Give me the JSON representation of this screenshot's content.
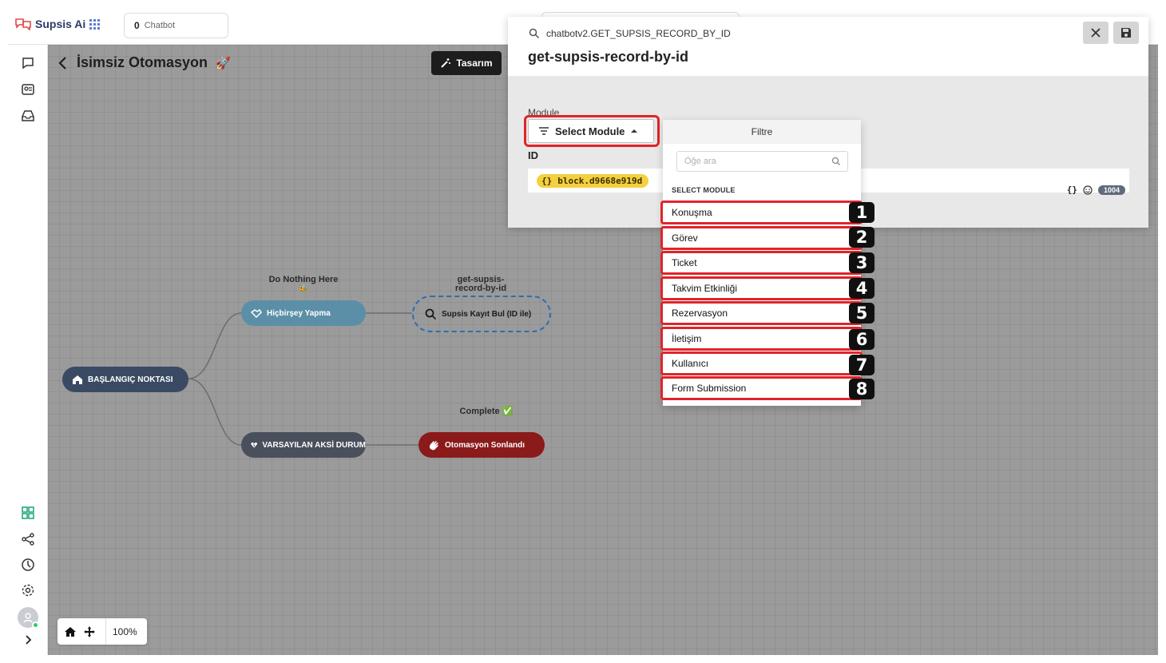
{
  "app": {
    "brand": "Supsis Ai",
    "chatbot_count": "0",
    "chatbot_label": "Chatbot"
  },
  "canvas": {
    "title": "İsimsiz Otomasyon",
    "title_emoji": "🚀",
    "design_button": "Tasarım",
    "zoom": "100%",
    "nodes": {
      "start": "BAŞLANGIÇ NOKTASI",
      "nothing": "Hiçbirşey Yapma",
      "nothing_caption": "Do Nothing Here",
      "nothing_emoji": "🐝",
      "find": "Supsis Kayıt Bul (ID ile)",
      "find_caption_1": "get-supsis-",
      "find_caption_2": "record-by-id",
      "default": "VARSAYILAN AKSİ DURUM",
      "end": "Otomasyon Sonlandı",
      "end_caption": "Complete",
      "end_emoji": "✅"
    }
  },
  "modal": {
    "path": "chatbotv2.GET_SUPSIS_RECORD_BY_ID",
    "title": "get-supsis-record-by-id",
    "module_label": "Module",
    "select_label": "Select Module",
    "id_label": "ID",
    "id_chip": "block.d9668e919d",
    "char_count": "1004"
  },
  "dropdown": {
    "header": "Filtre",
    "search_placeholder": "Öğe ara",
    "section": "SELECT MODULE",
    "items": [
      {
        "label": "Konuşma",
        "n": "1"
      },
      {
        "label": "Görev",
        "n": "2"
      },
      {
        "label": "Ticket",
        "n": "3"
      },
      {
        "label": "Takvim Etkinliği",
        "n": "4"
      },
      {
        "label": "Rezervasyon",
        "n": "5"
      },
      {
        "label": "İletişim",
        "n": "6"
      },
      {
        "label": "Kullanıcı",
        "n": "7"
      },
      {
        "label": "Form Submission",
        "n": "8"
      }
    ]
  },
  "colors": {
    "accent_red": "#e0242a",
    "node_blue": "#5b8fa8",
    "node_dark": "#3b4a63",
    "node_end": "#8b1a1a",
    "chip_yellow": "#f4d03f"
  }
}
